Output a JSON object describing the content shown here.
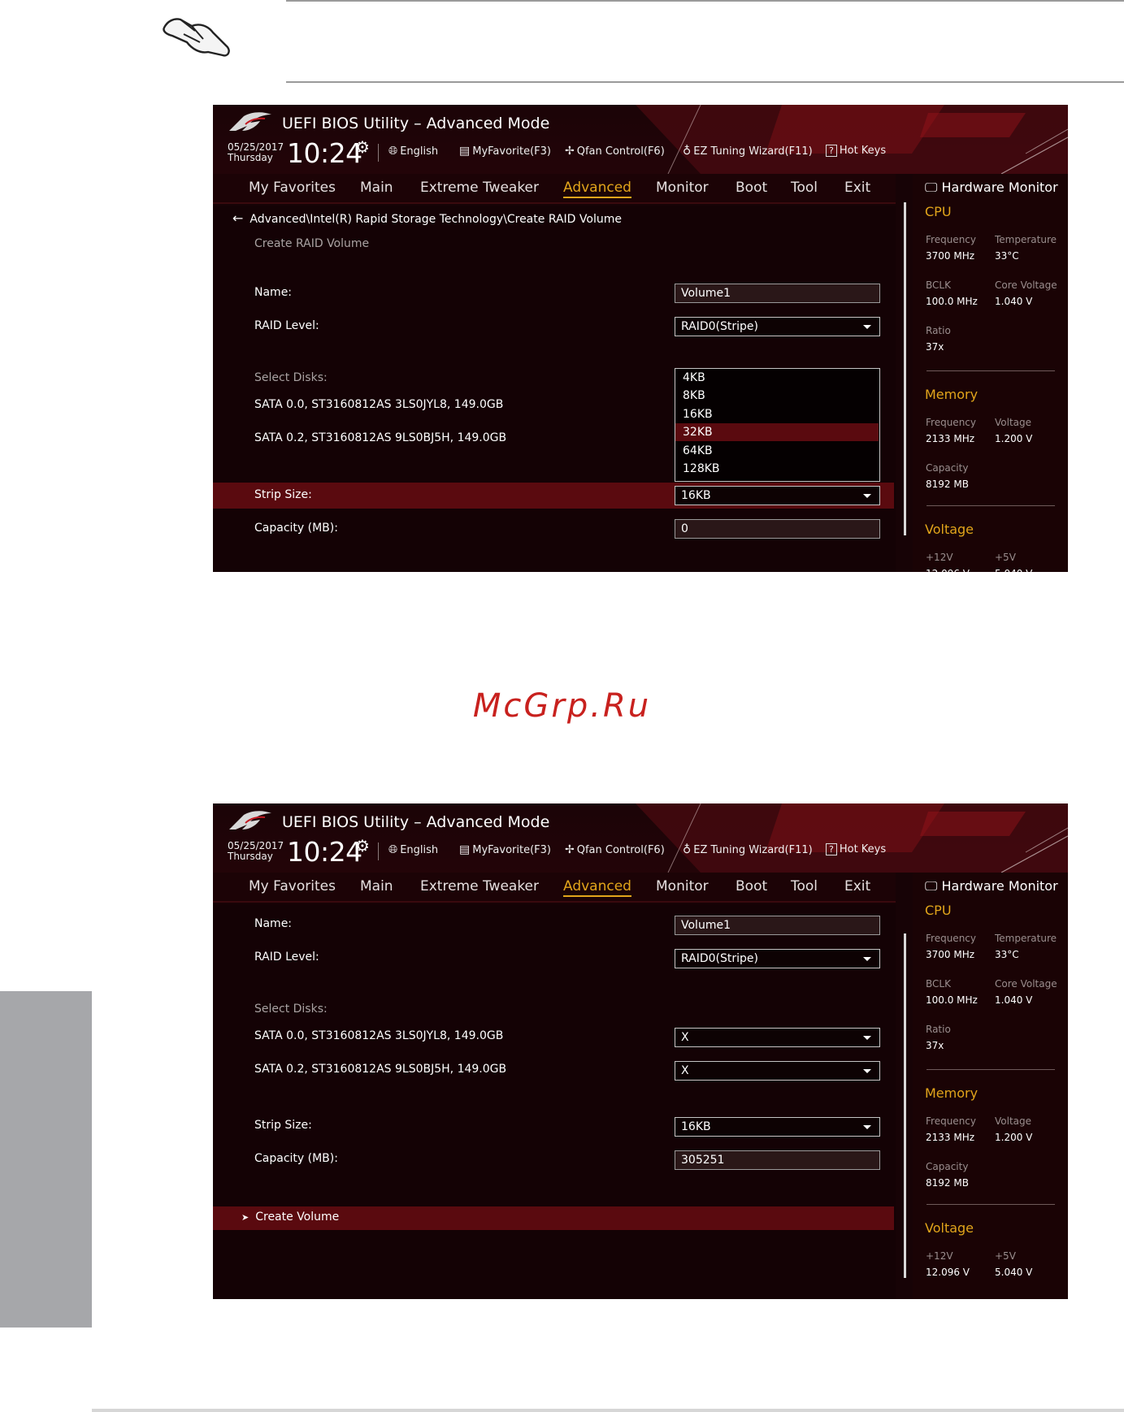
{
  "header": {
    "title": "UEFI BIOS Utility – Advanced Mode",
    "date": "05/25/2017",
    "day": "Thursday",
    "time": "10:24",
    "toolbar": {
      "language": "English",
      "favorite": "MyFavorite(F3)",
      "qfan": "Qfan Control(F6)",
      "ez_tuning": "EZ Tuning Wizard(F11)",
      "hot_keys": "Hot Keys"
    }
  },
  "nav": {
    "tabs": [
      {
        "label": "My Favorites"
      },
      {
        "label": "Main"
      },
      {
        "label": "Extreme Tweaker"
      },
      {
        "label": "Advanced"
      },
      {
        "label": "Monitor"
      },
      {
        "label": "Boot"
      },
      {
        "label": "Tool"
      },
      {
        "label": "Exit"
      }
    ],
    "active": "Advanced"
  },
  "screen1": {
    "breadcrumb": "Advanced\\Intel(R) Rapid Storage Technology\\Create RAID Volume",
    "subtitle": "Create RAID Volume",
    "name_label": "Name:",
    "name_value": "Volume1",
    "raid_label": "RAID Level:",
    "raid_value": "RAID0(Stripe)",
    "select_disks_label": "Select Disks:",
    "disk1": "SATA 0.0, ST3160812AS 3LS0JYL8, 149.0GB",
    "disk2": "SATA 0.2, ST3160812AS 9LS0BJ5H, 149.0GB",
    "strip_label": "Strip Size:",
    "strip_value": "16KB",
    "capacity_label": "Capacity (MB):",
    "capacity_value": "0",
    "strip_options": [
      "4KB",
      "8KB",
      "16KB",
      "32KB",
      "64KB",
      "128KB"
    ],
    "strip_highlighted": "32KB"
  },
  "screen2": {
    "name_label": "Name:",
    "name_value": "Volume1",
    "raid_label": "RAID Level:",
    "raid_value": "RAID0(Stripe)",
    "select_disks_label": "Select Disks:",
    "disk1": "SATA 0.0, ST3160812AS 3LS0JYL8, 149.0GB",
    "disk1_value": "X",
    "disk2": "SATA 0.2, ST3160812AS 9LS0BJ5H, 149.0GB",
    "disk2_value": "X",
    "strip_label": "Strip Size:",
    "strip_value": "16KB",
    "capacity_label": "Capacity (MB):",
    "capacity_value": "305251",
    "create_volume": "Create Volume"
  },
  "hw_monitor": {
    "title": "Hardware Monitor",
    "cpu": {
      "heading": "CPU",
      "freq_label": "Frequency",
      "freq": "3700 MHz",
      "temp_label": "Temperature",
      "temp": "33°C",
      "bclk_label": "BCLK",
      "bclk": "100.0 MHz",
      "vcore_label": "Core Voltage",
      "vcore": "1.040 V",
      "ratio_label": "Ratio",
      "ratio": "37x"
    },
    "memory": {
      "heading": "Memory",
      "freq_label": "Frequency",
      "freq": "2133 MHz",
      "volt_label": "Voltage",
      "volt": "1.200 V",
      "cap_label": "Capacity",
      "cap": "8192 MB"
    },
    "voltage": {
      "heading": "Voltage",
      "v12_label": "+12V",
      "v12": "12.096 V",
      "v5_label": "+5V",
      "v5": "5.040 V"
    }
  },
  "watermark": "McGrp.Ru",
  "colors": {
    "accent": "#e2a51b",
    "highlight": "#5a0a0f",
    "background": "#170306",
    "watermark": "#c8211e"
  }
}
